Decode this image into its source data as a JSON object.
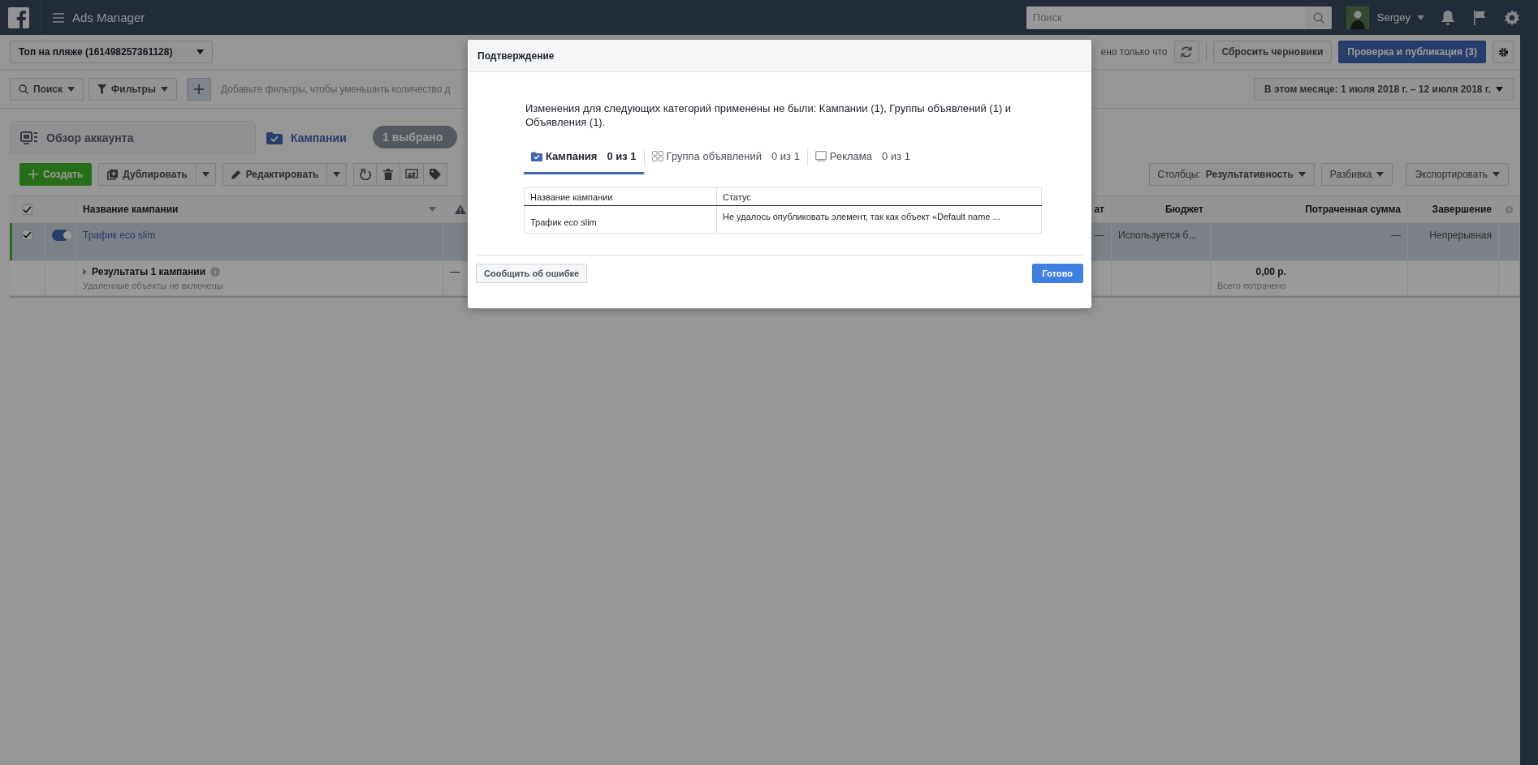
{
  "top_bar": {
    "app_title": "Ads Manager",
    "search": {
      "placeholder": "Поиск"
    },
    "user": {
      "name": "Sergey"
    }
  },
  "account_bar": {
    "account": "Топ на пляже (161498257361128)",
    "save_status": "ено только что",
    "reset_button": "Сбросить черновики",
    "publish_button": "Проверка и публикация (3)"
  },
  "filter_bar": {
    "search_button": "Поиск",
    "filters_button": "Фильтры",
    "hint": "Добавьте фильтры, чтобы уменьшить количество д",
    "date_range": "В этом месяце: 1 июля 2018 г. – 12 июля 2018 г."
  },
  "tabs": [
    {
      "kind": "account",
      "label": "Обзор аккаунта",
      "selected": false
    },
    {
      "kind": "campaigns",
      "label": "Кампании",
      "selected": true
    }
  ],
  "selection_badge": "1 выбрано",
  "toolbar": {
    "create": "Создать",
    "duplicate": "Дублировать",
    "edit": "Редактировать",
    "columns_label": "Столбцы:",
    "columns_value": "Результативность",
    "breakdown": "Разбивка",
    "export": "Экспортировать"
  },
  "table": {
    "header_checked": true,
    "columns": [
      "Название кампании",
      "ат",
      "Бюджет",
      "Потраченная сумма",
      "Завершение"
    ],
    "rows": [
      {
        "selected": true,
        "on": true,
        "cells": [
          "Трафик eco slim",
          "—",
          "Используется б...",
          "—",
          "Непрерывная"
        ]
      }
    ],
    "summary": {
      "title": "Результаты 1 кампании",
      "note": "Удаленные объекты не включены",
      "column_2": "—",
      "spent": "0,00 р.",
      "spent_note": "Всего потрачено"
    }
  },
  "dialog": {
    "title": "Подтверждение",
    "message": "Изменения для следующих категорий применены не были: Кампании (1), Группы объявлений (1) и Объявления (1).",
    "tabs": [
      {
        "kind": "campaign",
        "label": "Кампания",
        "count": "0 из 1",
        "selected": true
      },
      {
        "kind": "ad_set",
        "label": "Группа объявлений",
        "count": "0 из 1",
        "selected": false
      },
      {
        "kind": "ad",
        "label": "Реклама",
        "count": "0 из 1",
        "selected": false
      }
    ],
    "columns": [
      "Название кампании",
      "Статус"
    ],
    "rows": [
      [
        "Трафик eco slim",
        "Не удалось опубликовать элемент, так как объект «Default name ..."
      ]
    ],
    "report_button": "Сообщить об ошибке",
    "done_button": "Готово"
  }
}
